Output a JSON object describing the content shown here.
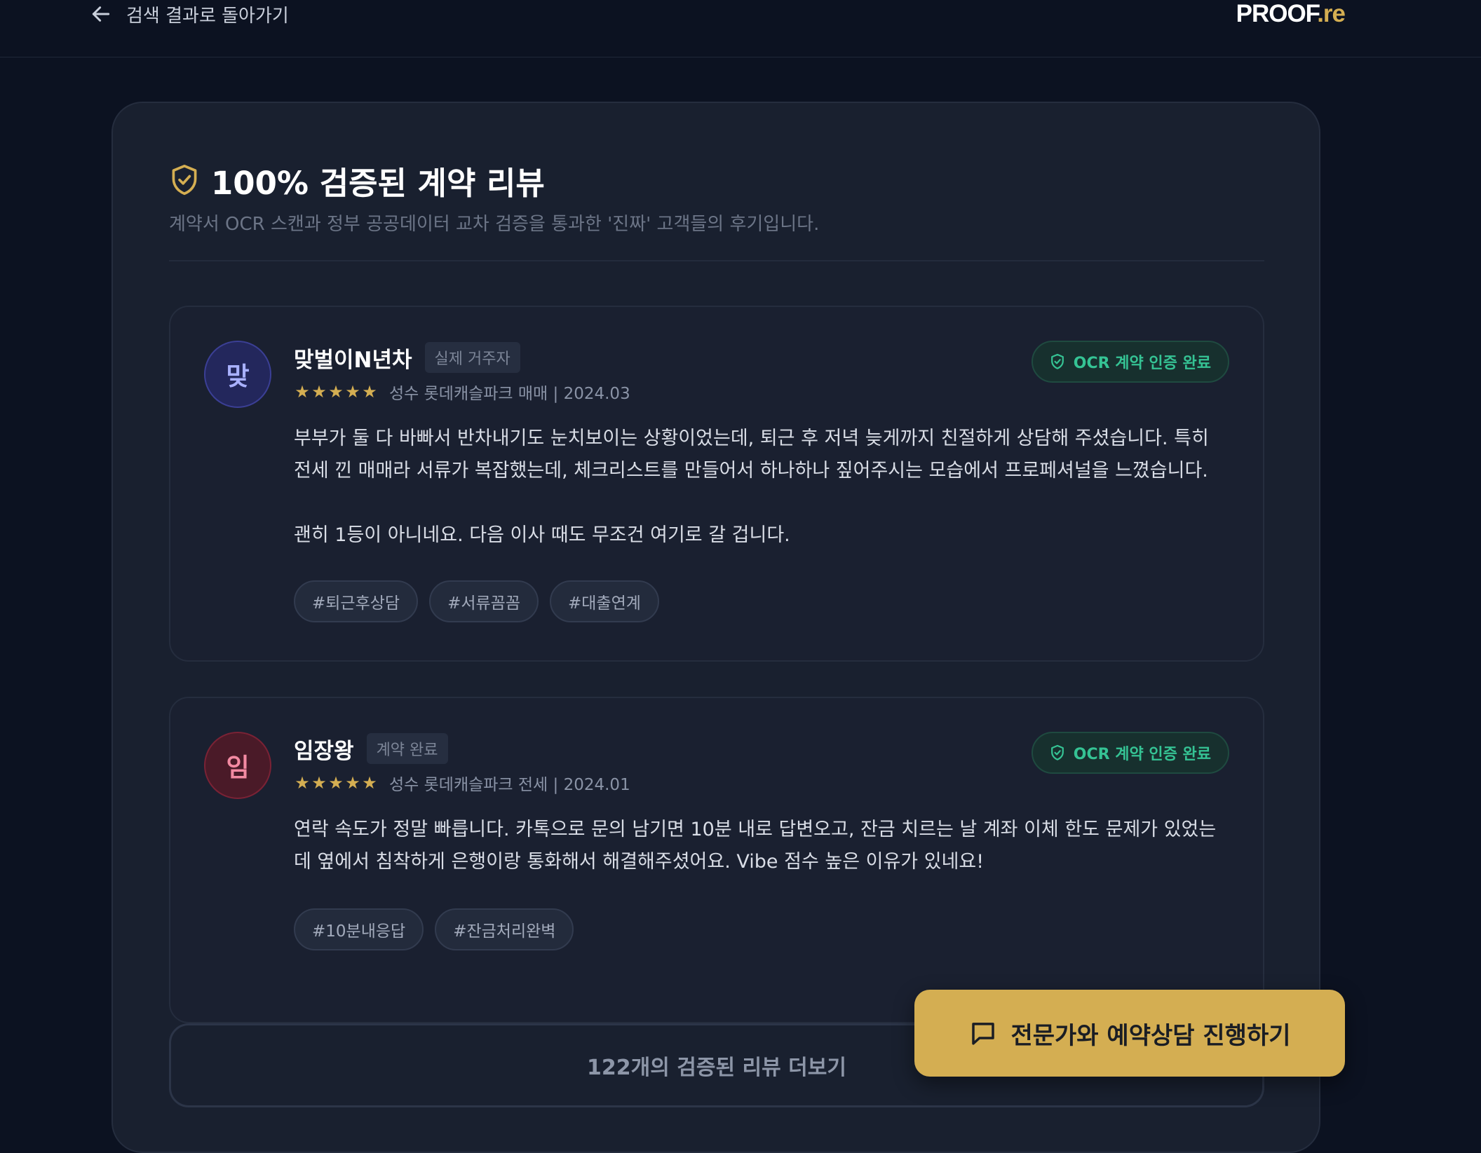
{
  "nav": {
    "back_label": "검색 결과로 돌아가기",
    "logo_main": "PROOF",
    "logo_suffix": ".re"
  },
  "section": {
    "title": "100% 검증된 계약 리뷰",
    "subtitle": "계약서 OCR 스캔과 정부 공공데이터 교차 검증을 통과한 '진짜' 고객들의 후기입니다."
  },
  "reviews": [
    {
      "avatar_initial": "맞",
      "name": "맞벌이N년차",
      "role": "실제 거주자",
      "rating": 5,
      "stars": "★",
      "meta": "성수 롯데캐슬파크 매매 | 2024.03",
      "badge": "OCR 계약 인증 완료",
      "body": [
        "부부가 둘 다 바빠서 반차내기도 눈치보이는 상황이었는데, 퇴근 후 저녁 늦게까지 친절하게 상담해 주셨습니다. 특히 전세 낀 매매라 서류가 복잡했는데, 체크리스트를 만들어서 하나하나 짚어주시는 모습에서 프로페셔널을 느꼈습니다.",
        "괜히 1등이 아니네요. 다음 이사 때도 무조건 여기로 갈 겁니다."
      ],
      "tags": [
        "#퇴근후상담",
        "#서류꼼꼼",
        "#대출연계"
      ]
    },
    {
      "avatar_initial": "임",
      "name": "임장왕",
      "role": "계약 완료",
      "rating": 5,
      "stars": "★",
      "meta": "성수 롯데캐슬파크 전세 | 2024.01",
      "badge": "OCR 계약 인증 완료",
      "body": [
        "연락 속도가 정말 빠릅니다. 카톡으로 문의 남기면 10분 내로 답변오고, 잔금 치르는 날 계좌 이체 한도 문제가 있었는데 옆에서 침착하게 은행이랑 통화해서 해결해주셨어요. Vibe 점수 높은 이유가 있네요!"
      ],
      "tags": [
        "#10분내응답",
        "#잔금처리완벽"
      ]
    }
  ],
  "more_button": "122개의 검증된 리뷰 더보기",
  "cta": {
    "label": "전문가와 예약상담 진행하기",
    "icon": "chat-bubble-icon"
  },
  "colors": {
    "background": "#0c1221",
    "panel": "#19202f",
    "accent_gold": "#d4ae52",
    "verified_green": "#35c394"
  }
}
